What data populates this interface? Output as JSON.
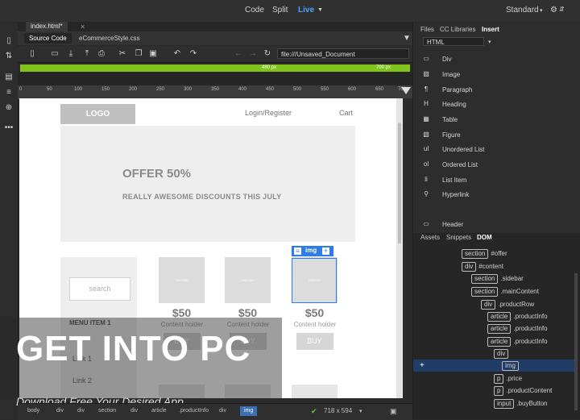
{
  "topbar": {
    "view_code": "Code",
    "view_split": "Split",
    "view_live": "Live",
    "workspace": "Standard"
  },
  "doc": {
    "tab_name": "index.html*",
    "related_files": [
      "Source Code",
      "eCommerceStyle.css"
    ],
    "url": "file:///Unsaved_Document"
  },
  "mq": {
    "min": "480  px",
    "max": "700  px"
  },
  "ruler": [
    "0",
    "50",
    "100",
    "150",
    "200",
    "250",
    "300",
    "350",
    "400",
    "450",
    "500",
    "550",
    "600",
    "650",
    "700"
  ],
  "page": {
    "logo": "LOGO",
    "login": "Login/Register",
    "cart": "Cart",
    "offer": "OFFER 50%",
    "discount": "REALLY AWESOME DISCOUNTS THIS JULY",
    "search_placeholder": "search",
    "menu_title": "MENU ITEM 1",
    "links": [
      "Link 1",
      "Link 2"
    ],
    "img_placeholder": "200X200",
    "price": "$50",
    "holder": "Content holder",
    "buy": "BUY",
    "selected_tag": "img"
  },
  "watermark": {
    "main_a": "GET ",
    "main_b": "INTO",
    "main_c": " PC",
    "sub": "Download Free Your Desired App"
  },
  "status": {
    "crumbs": [
      "body",
      "div",
      "div",
      "section",
      "div",
      "article",
      ".productInfo",
      "div",
      "img"
    ],
    "size": "718 x 594"
  },
  "panel": {
    "tabs": [
      "Files",
      "CC Libraries",
      "Insert"
    ],
    "category": "HTML",
    "insert_items": [
      "Div",
      "Image",
      "Paragraph",
      "Heading",
      "Table",
      "Figure",
      "Unordered List",
      "Ordered List",
      "List Item",
      "Hyperlink",
      "Header"
    ],
    "bottom_tabs": [
      "Assets",
      "Snippets",
      "DOM"
    ],
    "dom": [
      {
        "tag": "section",
        "label": "#offer"
      },
      {
        "tag": "div",
        "label": "#content"
      },
      {
        "tag": "section",
        "label": ".sidebar"
      },
      {
        "tag": "section",
        "label": ".mainContent"
      },
      {
        "tag": "div",
        "label": ".productRow"
      },
      {
        "tag": "article",
        "label": ".productInfo"
      },
      {
        "tag": "article",
        "label": ".productInfo"
      },
      {
        "tag": "article",
        "label": ".productInfo"
      },
      {
        "tag": "div",
        "label": ""
      },
      {
        "tag": "img",
        "label": ""
      },
      {
        "tag": "p",
        "label": ".price"
      },
      {
        "tag": "p",
        "label": ".productContent"
      },
      {
        "tag": "input",
        "label": ".buyButton"
      }
    ]
  },
  "colors": {
    "accent": "#4aa3ff",
    "mq_green": "#7fc31b",
    "selection": "#2d7ce8"
  }
}
